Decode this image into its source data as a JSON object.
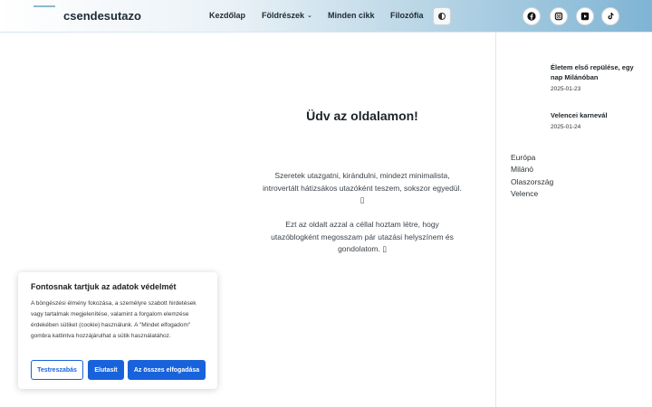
{
  "header": {
    "logo_text": "csendesutazo",
    "nav": [
      {
        "label": "Kezdőlap"
      },
      {
        "label": "Földrészek"
      },
      {
        "label": "Minden cikk"
      },
      {
        "label": "Filozófia"
      }
    ],
    "theme_icon": "contrast-icon",
    "social": [
      {
        "icon": "facebook-icon"
      },
      {
        "icon": "instagram-icon"
      },
      {
        "icon": "youtube-icon"
      },
      {
        "icon": "tiktok-icon"
      }
    ]
  },
  "main": {
    "title": "Üdv az oldalamon!",
    "paragraph1": "Szeretek utazgatni, kirándulni, mindezt minimalista, introvertált hátizsákos utazóként teszem, sokszor egyedül. ▯",
    "paragraph2": "Ezt az oldalt azzal a céllal hoztam létre, hogy utazóblogként megosszam pár utazási helyszínem és gondolatom. ▯"
  },
  "sidebar": {
    "posts": [
      {
        "title": "Életem első repülése, egy nap Milánóban",
        "date": "2025-01-23"
      },
      {
        "title": "Velencei karnevál",
        "date": "2025-01-24"
      }
    ],
    "tags": [
      "Európa",
      "Milánó",
      "Olaszország",
      "Velence"
    ]
  },
  "cookie_banner": {
    "title": "Fontosnak tartjuk az adatok védelmét",
    "text": "A böngészési élmény fokozása, a személyre szabott hirdetések vagy tartalmak megjelenítése, valamint a forgalom elemzése érdekében sütiket (cookie) használunk. A \"Mindet elfogadom\" gombra kattintva hozzájárulhat a sütik használatához.",
    "customize_label": "Testreszabás",
    "reject_label": "Elutasít",
    "accept_all_label": "Az összes elfogadása",
    "accent_color": "#1863dc"
  }
}
